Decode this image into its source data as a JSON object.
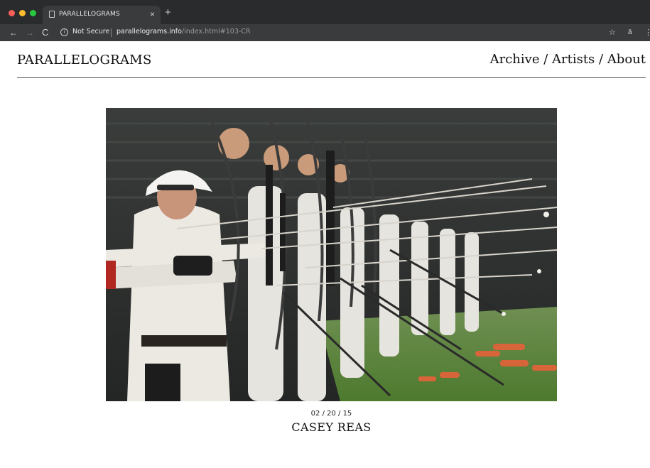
{
  "browser": {
    "tab_title": "PARALLELOGRAMS",
    "tab_close": "×",
    "new_tab": "+",
    "nav": {
      "back": "←",
      "forward": "→",
      "reload": "C"
    },
    "security_label": "Not Secure",
    "url_host": "parallelograms.info",
    "url_path": "/index.html#103-CR",
    "icons": {
      "bookmark": "☆",
      "extension": "ä",
      "menu": "⋮"
    }
  },
  "site": {
    "logo": "PARALLELOGRAMS",
    "nav": {
      "archive": "Archive",
      "artists": "Artists",
      "about": "About",
      "separator": " / "
    }
  },
  "artwork": {
    "alt": "Photograph of a line of archers drawing bows",
    "date": "02 / 20 / 15",
    "artist": "CASEY REAS"
  },
  "colors": {
    "chrome_dark": "#1f2021",
    "chrome_tab": "#3a3b3d",
    "grass": "#5f8a3c",
    "stands": "#2b2e2c"
  }
}
